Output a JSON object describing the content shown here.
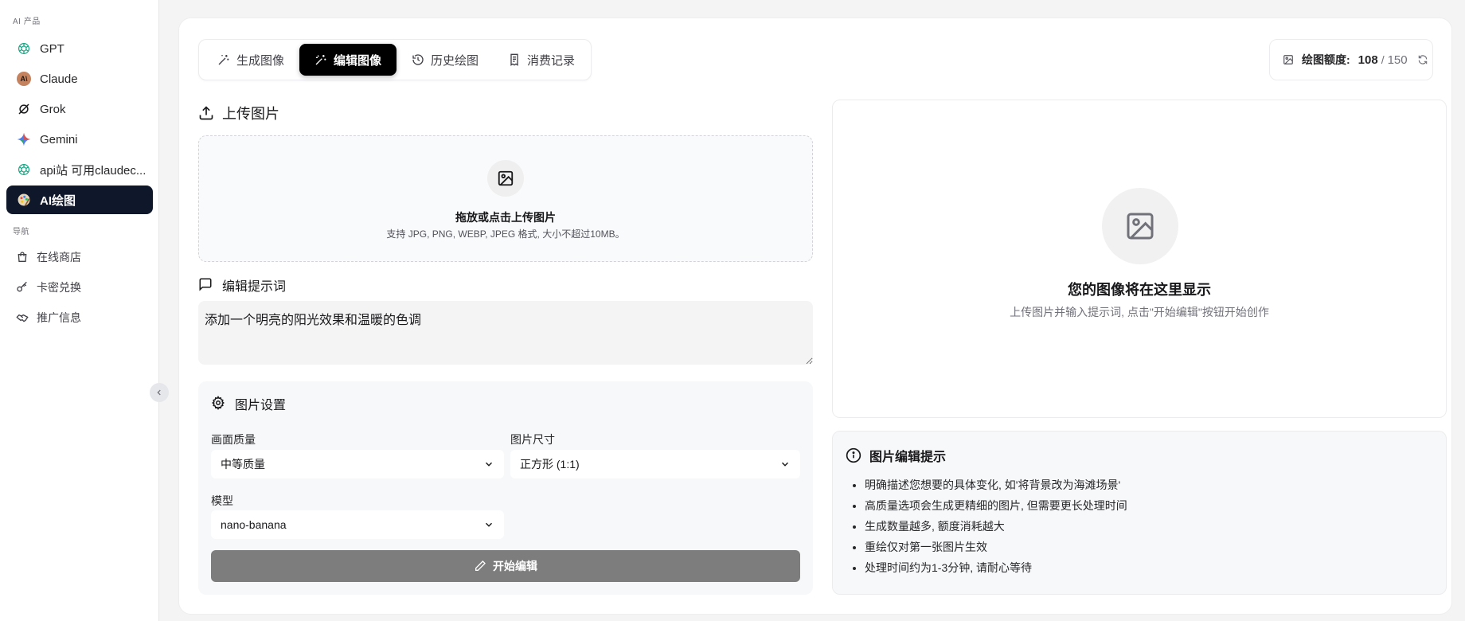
{
  "sidebar": {
    "section_ai": "AI 产品",
    "ai_items": [
      {
        "label": "GPT",
        "icon": "openai-icon"
      },
      {
        "label": "Claude",
        "icon": "claude-icon"
      },
      {
        "label": "Grok",
        "icon": "grok-icon"
      },
      {
        "label": "Gemini",
        "icon": "gemini-icon"
      },
      {
        "label": "api站 可用claudec...",
        "icon": "openai-icon"
      },
      {
        "label": "AI绘图",
        "icon": "palette-icon",
        "active": true
      }
    ],
    "claude_avatar_text": "A\\",
    "section_nav": "导航",
    "nav_items": [
      {
        "label": "在线商店",
        "icon": "shopping-bag-icon"
      },
      {
        "label": "卡密兑换",
        "icon": "key-icon"
      },
      {
        "label": "推广信息",
        "icon": "handshake-icon"
      }
    ]
  },
  "tabs": [
    {
      "label": "生成图像",
      "icon": "magic-wand-icon"
    },
    {
      "label": "编辑图像",
      "icon": "edit-wand-icon",
      "active": true
    },
    {
      "label": "历史绘图",
      "icon": "history-icon"
    },
    {
      "label": "消费记录",
      "icon": "receipt-icon"
    }
  ],
  "quota": {
    "label": "绘图额度:",
    "used": "108",
    "separator": "/",
    "total": "150"
  },
  "upload": {
    "title": "上传图片",
    "drop_title": "拖放或点击上传图片",
    "drop_hint": "支持 JPG, PNG, WEBP, JPEG 格式, 大小不超过10MB。"
  },
  "prompt": {
    "title": "编辑提示词",
    "value": "添加一个明亮的阳光效果和温暖的色调"
  },
  "settings": {
    "title": "图片设置",
    "quality_label": "画面质量",
    "quality_value": "中等质量",
    "size_label": "图片尺寸",
    "size_value": "正方形 (1:1)",
    "model_label": "模型",
    "model_value": "nano-banana",
    "start_button": "开始编辑"
  },
  "preview": {
    "title": "您的图像将在这里显示",
    "subtitle": "上传图片并输入提示词, 点击\"开始编辑\"按钮开始创作"
  },
  "tips": {
    "title": "图片编辑提示",
    "items": [
      "明确描述您想要的具体变化, 如'将背景改为海滩场景'",
      "高质量选项会生成更精细的图片, 但需要更长处理时间",
      "生成数量越多, 额度消耗越大",
      "重绘仅对第一张图片生效",
      "处理时间约为1-3分钟, 请耐心等待"
    ]
  },
  "colors": {
    "active_nav_bg": "#0f172a",
    "active_tab_bg": "#000000",
    "start_button_bg": "#7d7d7d",
    "openai_green": "#10a37f"
  }
}
